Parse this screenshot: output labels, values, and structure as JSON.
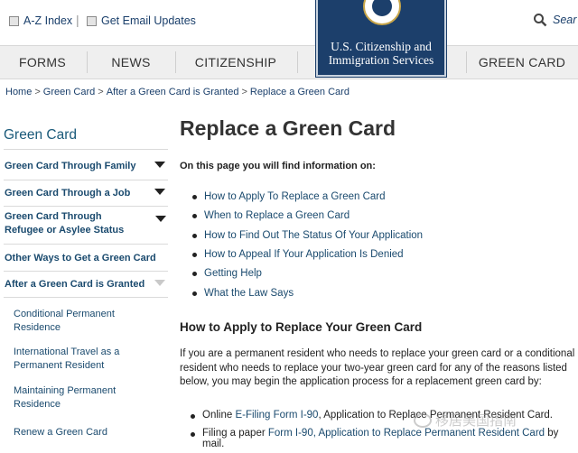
{
  "util": {
    "az_index": "A-Z Index",
    "separator": "|",
    "email_updates": "Get Email Updates",
    "search_label": "Sear"
  },
  "logo": {
    "line1": "U.S. Citizenship and",
    "line2": "Immigration Services"
  },
  "nav": {
    "items": [
      "FORMS",
      "NEWS",
      "CITIZENSHIP",
      "GREEN CARD"
    ]
  },
  "breadcrumb": {
    "items": [
      "Home",
      "Green Card",
      "After a Green Card is Granted",
      "Replace a Green Card"
    ],
    "sep": ">"
  },
  "sidebar": {
    "title": "Green Card",
    "items": [
      "Green Card Through Family",
      "Green Card Through a Job",
      "Green Card Through Refugee or Asylee Status",
      "Other Ways to Get a Green Card",
      "After a Green Card is Granted"
    ],
    "subitems": [
      "Conditional Permanent Residence",
      "International Travel as a Permanent Resident",
      "Maintaining Permanent Residence",
      "Renew a Green Card"
    ]
  },
  "main": {
    "title": "Replace a Green Card",
    "intro": "On this page you will find information on:",
    "toc": [
      "How to Apply To Replace a Green Card",
      "When to Replace a Green Card",
      "How to Find Out The Status Of Your Application",
      "How to Appeal If Your Application Is Denied",
      "Getting Help",
      "What the Law Says"
    ],
    "section_title": "How to Apply to Replace Your Green Card",
    "para_lines": [
      "If you are a permanent resident who needs to replace your green card or a conditional",
      "resident who needs to replace your two-year green card for any of the reasons listed",
      "below, you may begin the application process for a replacement green card by:"
    ],
    "list": [
      {
        "pre": "Online ",
        "link": "E-Filing Form I-90",
        "post": ", Application to Replace Permanent Resident Card."
      },
      {
        "pre": "Filing a paper ",
        "link": "Form I-90, Application to Replace Permanent Resident Card",
        "post": " by",
        "line2": "mail."
      }
    ]
  },
  "watermark": "移居美国指南"
}
